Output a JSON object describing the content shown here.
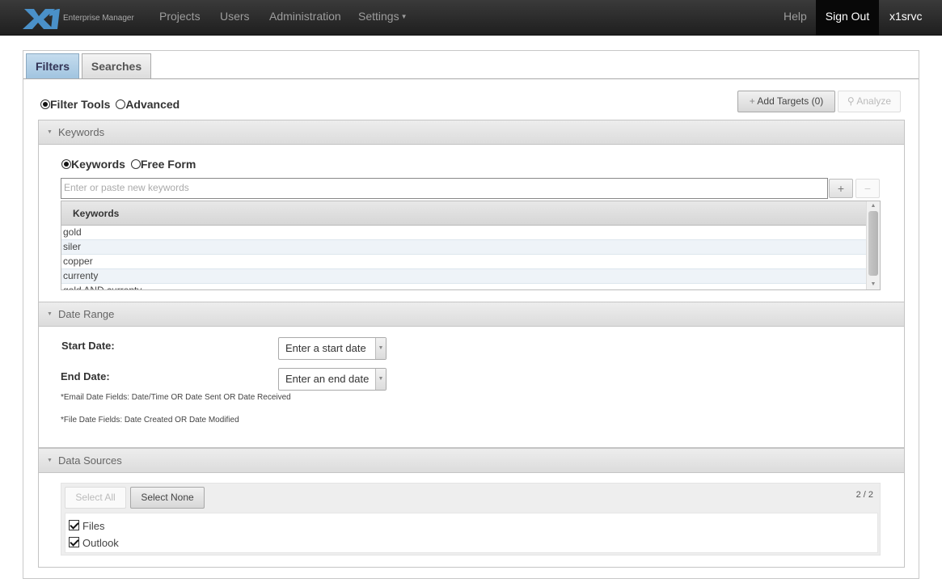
{
  "nav": {
    "logo_text": "Enterprise Manager",
    "items": [
      {
        "label": "Projects"
      },
      {
        "label": "Users"
      },
      {
        "label": "Administration"
      },
      {
        "label": "Settings"
      }
    ],
    "help": "Help",
    "signout": "Sign Out",
    "user": "x1srvc"
  },
  "tabs": [
    {
      "label": "Filters",
      "active": true
    },
    {
      "label": "Searches",
      "active": false
    }
  ],
  "mode": {
    "filter_tools": "Filter Tools",
    "advanced": "Advanced"
  },
  "actions": {
    "add_targets": "Add Targets (0)",
    "analyze": "Analyze"
  },
  "keywords": {
    "section_title": "Keywords",
    "mode_keywords": "Keywords",
    "mode_free_form": "Free Form",
    "input_placeholder": "Enter or paste new keywords",
    "add": "+",
    "remove": "−",
    "column_header": "Keywords",
    "rows": [
      "gold",
      "siler",
      "copper",
      "currenty",
      "gold AND currenty"
    ]
  },
  "date_range": {
    "section_title": "Date Range",
    "start_label": "Start Date:",
    "start_placeholder": "Enter a start date",
    "end_label": "End Date:",
    "end_placeholder": "Enter an end date",
    "note_email": "*Email Date Fields: Date/Time OR Date Sent OR Date Received",
    "note_file": "*File Date Fields: Date Created OR Date Modified"
  },
  "data_sources": {
    "section_title": "Data Sources",
    "select_all": "Select All",
    "select_none": "Select None",
    "count": "2 / 2",
    "items": [
      {
        "label": "Files",
        "checked": true
      },
      {
        "label": "Outlook",
        "checked": true
      }
    ]
  },
  "colors": {
    "navbar": "#222222",
    "active_tab": "#9fc3df"
  }
}
